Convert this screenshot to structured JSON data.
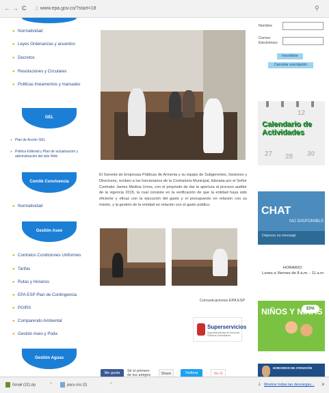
{
  "browser": {
    "back": "←",
    "forward": "→",
    "reload": "C",
    "url": "www.epa.gov.co/?start=18",
    "zoom_icon": "magnifier-icon"
  },
  "sidebar": {
    "items_top": [
      "Normatividad",
      "Leyes Ordenanzas y acuerdos",
      "Decretos",
      "Resoluciones y Circulares",
      "Politicas lineamentos y manuales"
    ],
    "gel_header": "GEL",
    "gel_items": [
      "Plan de Acción GEL",
      "Politica Editorial y Plan de actualización y administración del sitio Web"
    ],
    "convivencia_header": "Comitè Convivencia",
    "convivencia_items": [
      "Normatividad"
    ],
    "aseo_header": "Gestión Aseo",
    "aseo_items": [
      "Contratos Condiciones Uniformes",
      "Tarifas",
      "Rutas y Horarios",
      "EPA ESP Plan de Contingencia",
      "PGIRS",
      "Comparendo Ambiental",
      "Gestión Aseo y Poda"
    ],
    "aguas_header": "Gestión Aguas"
  },
  "main": {
    "article": "El Gerente de Empresas Públicas de Armenia y su equipo de Subgerentes, Gestores y Directores, reciben a los funcionarios de la Contraloría Municipal, liderada por el Señor Contralor James Medina Urrea, con el propósito de dar la apertura al proceso auditor de la vigencia 2015, la cual consiste en la verificación de que la entidad haya sido eficiente y eficaz con la ejecución del gasto y el presupuesto en relación con su misión, y la gestión de la entidad en relación con el gasto público.",
    "credit": "Comunicaciones EPA ESP",
    "logo_name": "Superservicios",
    "logo_sub": "Superintendencia de Servicios Públicos Domiciliarios",
    "social": {
      "fb_label": "Me gusta",
      "fb_text": "Sé el primero de tus amigos",
      "share_label": "Share",
      "tweet_label": "Twittear",
      "gplus_label": "G+ 0"
    }
  },
  "right": {
    "nombre_label": "Nombre",
    "correo_label": "Correo Electrónico",
    "subscribe_label": "Inscribirse",
    "cancel_label": "Cancelar suscripción",
    "calendar_title": "Calendario de Actividades",
    "calendar_days": [
      "27",
      "28",
      "30",
      "12"
    ],
    "chat_word": "CHAT",
    "chat_status": "NO DISPONIBLE",
    "chat_message": "Dejenos su mensaje",
    "horario_title": "HORARIO:",
    "horario_text": "Lunes a Viernes de 8 a.m. - 11 a.m",
    "ninos_title": "NIÑOS Y NIÑAS",
    "ninos_badge": "EPA",
    "horarios_banner": "HORARIOS DE ATENCIÓN"
  },
  "downloads": {
    "items": [
      "Gmail (22).zip",
      "para cris (2)"
    ],
    "show_all": "Mostrar todas las descargas...",
    "close": "×"
  },
  "colors": {
    "sidebar_tab": "#1c7fd6",
    "sidebar_link": "#2c4b8a",
    "bullet": "#e4a126",
    "button_light_blue": "#9ed3f0"
  }
}
